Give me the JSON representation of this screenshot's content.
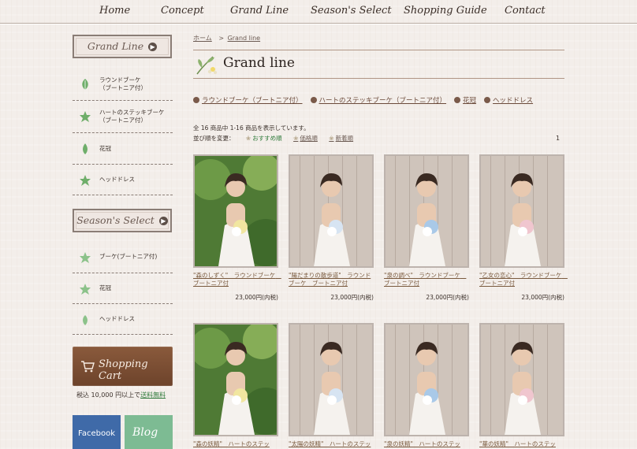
{
  "nav": [
    "Home",
    "Concept",
    "Grand Line",
    "Season's Select",
    "Shopping Guide",
    "Contact"
  ],
  "sidebar": {
    "grand_line_title": "Grand Line",
    "grand_line_items": [
      "ラウンドブーケ\n（ブートニア付）",
      "ハートのステッキブーケ\n（ブートニア付）",
      "花冠",
      "ヘッドドレス"
    ],
    "season_title": "Season's Select",
    "season_items": [
      "ブーケ(ブートニア付)",
      "花冠",
      "ヘッドドレス"
    ],
    "cart_label": "Shopping Cart",
    "cart_note_prefix": "税込 10,000 円以上で",
    "cart_note_link": "送料無料",
    "facebook_label": "Facebook",
    "blog_label": "Blog"
  },
  "breadcrumb": {
    "home": "ホーム",
    "separator": ">",
    "current": "Grand line"
  },
  "page_title": "Grand line",
  "categories": [
    "ラウンドブーケ（ブートニア付）",
    "ハートのステッキブーケ（ブートニア付）",
    "花冠",
    "ヘッドドレス"
  ],
  "result_count": "全 16 商品中 1-16 商品を表示しています。",
  "sort": {
    "label": "並び順を変更：",
    "options": [
      "おすすめ順",
      "価格順",
      "新着順"
    ],
    "active": "おすすめ順"
  },
  "page_number": "1",
  "products": [
    {
      "name": "\"森のしずく\"　ラウンドブーケ　ブートニア付",
      "price": "23,000円(内税)",
      "bg": "green"
    },
    {
      "name": "\"陽だまりの散歩道\"　ラウンドブーケ　ブートニア付",
      "price": "23,000円(内税)",
      "bg": "wood"
    },
    {
      "name": "\"泉の調べ\"　ラウンドブーケ　ブートニア付",
      "price": "23,000円(内税)",
      "bg": "wood"
    },
    {
      "name": "\"乙女の恋心\"　ラウンドブーケ　ブートニア付",
      "price": "23,000円(内税)",
      "bg": "wood"
    },
    {
      "name": "\"森の妖精\"　ハートのステッ",
      "price": "",
      "bg": "green"
    },
    {
      "name": "\"太陽の妖精\"　ハートのステッ",
      "price": "",
      "bg": "wood"
    },
    {
      "name": "\"泉の妖精\"　ハートのステッ",
      "price": "",
      "bg": "wood"
    },
    {
      "name": "\"華の妖精\"　ハートのステッ",
      "price": "",
      "bg": "wood"
    }
  ],
  "colors": {
    "accent_green": "#2f7a3a",
    "link_brown": "#7a5a3e",
    "cart_brown": "#7a4e33",
    "facebook_blue": "#3f6aa8",
    "blog_green": "#7dbb93"
  }
}
